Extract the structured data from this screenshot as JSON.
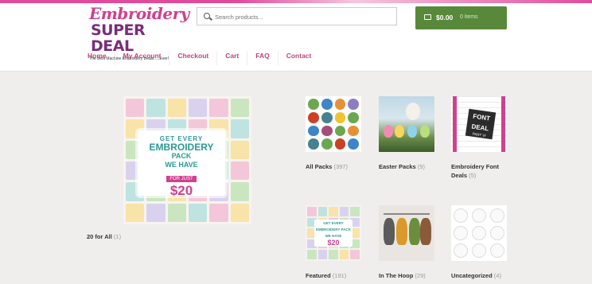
{
  "site": {
    "logo_line1": "Embroidery",
    "logo_line2": "SUPER DEAL",
    "logo_tagline": "The Best Machine Embroidery Deals.....Ever!"
  },
  "search": {
    "placeholder": "Search products..."
  },
  "cart": {
    "amount": "$0.00",
    "items": "0 items"
  },
  "nav": {
    "home": "Home",
    "my_account": "My Account",
    "checkout": "Checkout",
    "cart": "Cart",
    "faq": "FAQ",
    "contact": "Contact"
  },
  "feature": {
    "banner_line1": "GET EVERY",
    "banner_line2": "EMBROIDERY",
    "banner_line3": "PACK",
    "banner_line4": "WE HAVE",
    "banner_line5": "FOR JUST",
    "banner_price": "$20",
    "caption": "20 for All",
    "count": "(1)"
  },
  "categories": [
    {
      "name": "All Packs",
      "count": "(397)"
    },
    {
      "name": "Easter Packs",
      "count": "(9)"
    },
    {
      "name": "Embroidery Font Deals",
      "count": "(5)",
      "thumb_line1": "FONT",
      "thumb_line2": "DEAL",
      "thumb_line3": "PART VI"
    },
    {
      "name": "Featured",
      "count": "(191)",
      "thumb_line1": "GET EVERY",
      "thumb_line2": "EMBROIDERY PACK",
      "thumb_line3": "WE HAVE",
      "thumb_price": "$20"
    },
    {
      "name": "In The Hoop",
      "count": "(29)"
    },
    {
      "name": "Uncategorized",
      "count": "(4)"
    }
  ],
  "colors": {
    "accent_pink": "#d23f8e",
    "nav_pink": "#c0447f",
    "cart_green": "#58893b",
    "background": "#f0eeec"
  },
  "icons": {
    "search": "search-icon",
    "cart": "cart-icon"
  }
}
